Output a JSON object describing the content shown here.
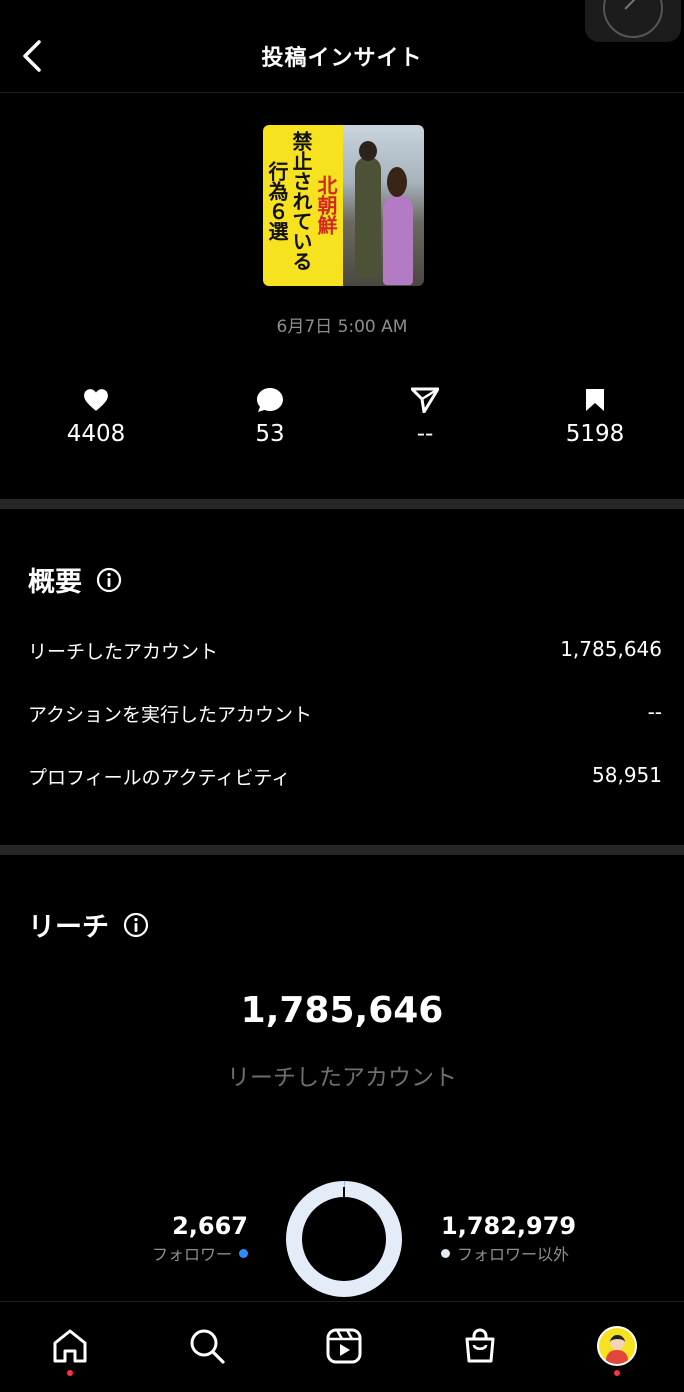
{
  "header": {
    "title": "投稿インサイト"
  },
  "post": {
    "thumbnail_text": {
      "red": "北朝鮮",
      "line1": "禁止されている",
      "line2": "行為６選"
    },
    "date": "6月7日 5:00 AM"
  },
  "stats": {
    "likes": "4408",
    "comments": "53",
    "shares": "--",
    "saves": "5198"
  },
  "overview": {
    "title": "概要",
    "rows": [
      {
        "label": "リーチしたアカウント",
        "value": "1,785,646"
      },
      {
        "label": "アクションを実行したアカウント",
        "value": "--"
      },
      {
        "label": "プロフィールのアクティビティ",
        "value": "58,951"
      }
    ]
  },
  "reach": {
    "title": "リーチ",
    "total": "1,785,646",
    "total_label": "リーチしたアカウント",
    "followers": {
      "value": "2,667",
      "label": "フォロワー"
    },
    "non_followers": {
      "value": "1,782,979",
      "label": "フォロワー以外"
    },
    "follower_fraction": 0.0015
  },
  "colors": {
    "follower": "#2a8cff",
    "non_follower": "#e3ecf7",
    "notification": "#ff3040"
  },
  "nav": {
    "items": [
      "home-icon",
      "search-icon",
      "reels-icon",
      "shop-icon",
      "profile-avatar"
    ]
  }
}
